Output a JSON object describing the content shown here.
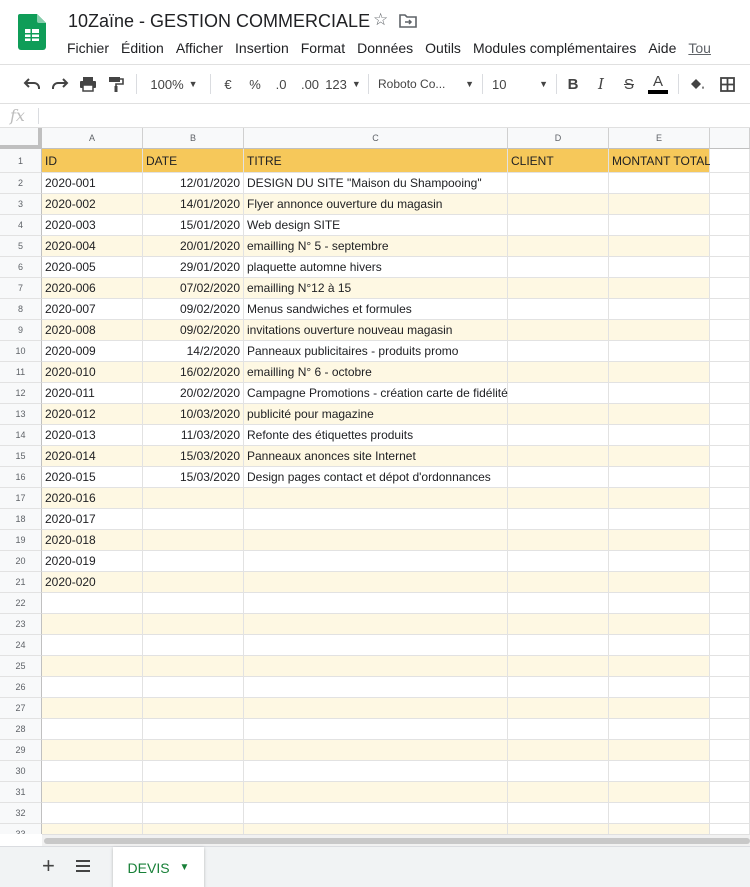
{
  "doc": {
    "title": "10Zaïne - GESTION COMMERCIALE"
  },
  "menu": [
    "Fichier",
    "Édition",
    "Afficher",
    "Insertion",
    "Format",
    "Données",
    "Outils",
    "Modules complémentaires",
    "Aide",
    "Tou"
  ],
  "toolbar": {
    "zoom": "100%",
    "currency": "€",
    "percent": "%",
    "decrease_decimal": ".0",
    "increase_decimal": ".00",
    "more_formats": "123",
    "font": "Roboto Co...",
    "font_size": "10",
    "bold": "B",
    "italic": "I",
    "strike": "S",
    "text_color": "A"
  },
  "formula": {
    "fx": "fx"
  },
  "columns": [
    {
      "letter": "A"
    },
    {
      "letter": "B"
    },
    {
      "letter": "C"
    },
    {
      "letter": "D"
    },
    {
      "letter": "E"
    }
  ],
  "header_row": {
    "num": "1",
    "cells": [
      "ID",
      "DATE",
      "TITRE",
      "CLIENT",
      "MONTANT TOTAL"
    ]
  },
  "rows": [
    {
      "num": "2",
      "id": "2020-001",
      "date": "12/01/2020",
      "titre": "DESIGN DU SITE \"Maison du  Shampooing\""
    },
    {
      "num": "3",
      "id": "2020-002",
      "date": "14/01/2020",
      "titre": "Flyer annonce ouverture du magasin"
    },
    {
      "num": "4",
      "id": "2020-003",
      "date": "15/01/2020",
      "titre": "Web design  SITE"
    },
    {
      "num": "5",
      "id": "2020-004",
      "date": "20/01/2020",
      "titre": "emailling N° 5 - septembre"
    },
    {
      "num": "6",
      "id": "2020-005",
      "date": "29/01/2020",
      "titre": "plaquette automne hivers"
    },
    {
      "num": "7",
      "id": "2020-006",
      "date": "07/02/2020",
      "titre": "emailling N°12 à 15"
    },
    {
      "num": "8",
      "id": "2020-007",
      "date": "09/02/2020",
      "titre": "Menus sandwiches et formules"
    },
    {
      "num": "9",
      "id": "2020-008",
      "date": "09/02/2020",
      "titre": "invitations ouverture nouveau magasin"
    },
    {
      "num": "10",
      "id": "2020-009",
      "date": "14/2/2020",
      "titre": "Panneaux publicitaires - produits promo"
    },
    {
      "num": "11",
      "id": "2020-010",
      "date": "16/02/2020",
      "titre": "emailling N° 6 - octobre"
    },
    {
      "num": "12",
      "id": "2020-011",
      "date": "20/02/2020",
      "titre": "Campagne Promotions - création carte de fidélité"
    },
    {
      "num": "13",
      "id": "2020-012",
      "date": "10/03/2020",
      "titre": "publicité pour magazine"
    },
    {
      "num": "14",
      "id": "2020-013",
      "date": "11/03/2020",
      "titre": "Refonte des étiquettes produits"
    },
    {
      "num": "15",
      "id": "2020-014",
      "date": "15/03/2020",
      "titre": "Panneaux anonces site Internet"
    },
    {
      "num": "16",
      "id": "2020-015",
      "date": "15/03/2020",
      "titre": "Design pages contact et dépot d'ordonnances"
    },
    {
      "num": "17",
      "id": "2020-016",
      "date": "",
      "titre": ""
    },
    {
      "num": "18",
      "id": "2020-017",
      "date": "",
      "titre": ""
    },
    {
      "num": "19",
      "id": "2020-018",
      "date": "",
      "titre": ""
    },
    {
      "num": "20",
      "id": "2020-019",
      "date": "",
      "titre": ""
    },
    {
      "num": "21",
      "id": "2020-020",
      "date": "",
      "titre": ""
    },
    {
      "num": "22",
      "id": "",
      "date": "",
      "titre": ""
    },
    {
      "num": "23",
      "id": "",
      "date": "",
      "titre": ""
    },
    {
      "num": "24",
      "id": "",
      "date": "",
      "titre": ""
    },
    {
      "num": "25",
      "id": "",
      "date": "",
      "titre": ""
    },
    {
      "num": "26",
      "id": "",
      "date": "",
      "titre": ""
    },
    {
      "num": "27",
      "id": "",
      "date": "",
      "titre": ""
    },
    {
      "num": "28",
      "id": "",
      "date": "",
      "titre": ""
    },
    {
      "num": "29",
      "id": "",
      "date": "",
      "titre": ""
    },
    {
      "num": "30",
      "id": "",
      "date": "",
      "titre": ""
    },
    {
      "num": "31",
      "id": "",
      "date": "",
      "titre": ""
    },
    {
      "num": "32",
      "id": "",
      "date": "",
      "titre": ""
    },
    {
      "num": "33",
      "id": "",
      "date": "",
      "titre": ""
    }
  ],
  "sheets": {
    "active": "DEVIS"
  },
  "colors": {
    "header_fill": "#f6c85a",
    "band_fill": "#fef8e3",
    "sheets_green": "#188038"
  }
}
